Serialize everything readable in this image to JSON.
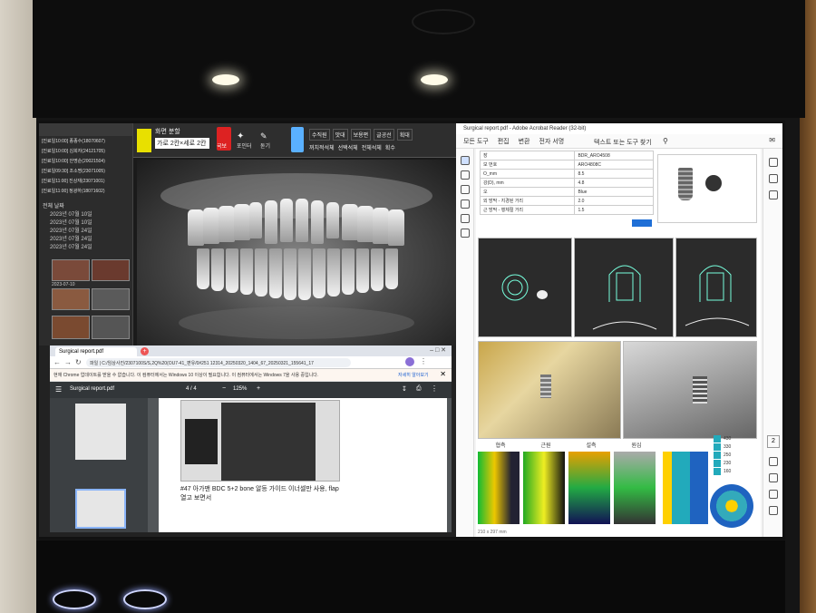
{
  "viewer": {
    "layout_label": "화면 분할",
    "layout_value": "가로 2칸×세로 2칸",
    "tools": [
      "국보",
      "포인터",
      "돋기",
      "회",
      "수직원",
      "맛대",
      "보용편",
      "글공선",
      "획대"
    ],
    "tools_row2": [
      "꺼치적석체",
      "선택석체",
      "전체석체",
      "획수"
    ],
    "patients": [
      "[진료일10:00] 종종수(18070607)",
      "[진료일10:00] 김희자(24121705)",
      "[진료일10:00] 안명순(20021504)",
      "[진료일09:30] 조소명(23071005)",
      "[진료일11:00] 진상재(23071001)",
      "[진료일11:00] 정광하(18071602)"
    ],
    "tree_root": "전체 날짜",
    "dates": [
      "2023년 07월 10일",
      "2023년 07월 10일",
      "2023년 07월 24일",
      "2023년 07월 24일",
      "2023년 07월 24일"
    ],
    "thumb_date": "2023-07-10"
  },
  "adobe": {
    "title": "Surgical report.pdf - Adobe Acrobat Reader (32-bit)",
    "menu": [
      "모든 도구",
      "편집",
      "변환",
      "전자 서명"
    ],
    "search": "텍스트 또는 도구 찾기",
    "table": [
      [
        "장",
        "BDR_ARO4508"
      ],
      [
        "모 번호",
        "ARO4808C"
      ],
      [
        "O_mm",
        "8.5"
      ],
      [
        "강(D), mm",
        "4.8"
      ],
      [
        "오",
        "Blue"
      ],
      [
        "외 방막 - 지경된 거리",
        "2.0"
      ],
      [
        "근 방막 - 행체절 거리",
        "1.5"
      ]
    ],
    "strip_labels": [
      "협측",
      "근원",
      "설측",
      "원심"
    ],
    "scale": [
      "430",
      "330",
      "250",
      "230",
      "160"
    ],
    "status": "210 x 297 mm",
    "page_badge": "2"
  },
  "browser": {
    "tab_title": "Surgical report.pdf",
    "url": "파일 | C:/임상사진/2307100S/S,2Q%20(OU7-41_편유/0#251 12314_20250320_1404_67_20250321_155641_17",
    "notice": "현재 Chrome 업데이트를 받을 수 없습니다. 이 컴퓨터에서는 Windows 10 이상이 필요합니다. 이 컴퓨터에서는 Windows 7을 사용 중입니다.",
    "notice_link": "자세히 알아보기",
    "pdf_name": "Surgical report.pdf",
    "page": "4 / 4",
    "zoom": "125%",
    "comment": "#47 아가맨 BDC 5+2 bone 알등 가이드 이너셀만 사용, flap열고 보면서"
  }
}
